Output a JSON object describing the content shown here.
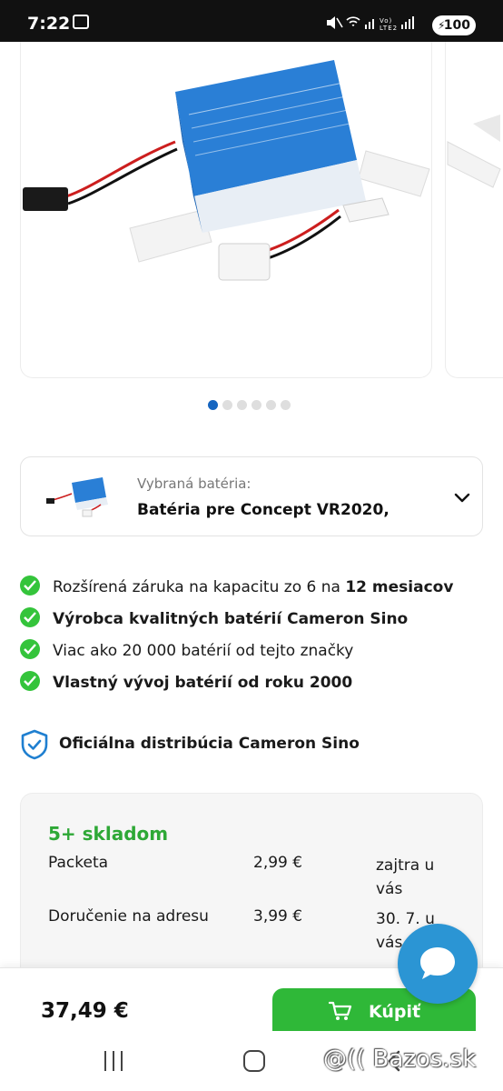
{
  "status_bar": {
    "time": "7:22",
    "signal_text": "Vo) LTE2",
    "battery": "100"
  },
  "gallery": {
    "dots_count": 6,
    "active_dot": 0
  },
  "selector": {
    "label": "Vybraná batéria:",
    "value": "Batéria pre Concept VR2020,"
  },
  "features": [
    {
      "pre": "Rozšírená záruka na kapacitu zo 6 na ",
      "bold": "12 mesiacov"
    },
    {
      "pre": "",
      "bold": "Výrobca kvalitných batérií Cameron Sino"
    },
    {
      "pre": "Viac ako 20 000 batérií od tejto značky",
      "bold": ""
    },
    {
      "pre": "",
      "bold": "Vlastný vývoj batérií od roku 2000"
    }
  ],
  "official": {
    "label": "Oficiálna distribúcia Cameron Sino"
  },
  "stock": {
    "title": "5+ skladom",
    "rows": [
      {
        "name": "Packeta",
        "price": "2,99 €",
        "when": "zajtra u vás"
      },
      {
        "name": "Doručenie na adresu",
        "price": "3,99 €",
        "when": "30. 7. u vás"
      }
    ]
  },
  "purchase": {
    "price": "37,49 €",
    "buy_label": "Kúpiť"
  },
  "watermark": "@(( Bazos.sk",
  "colors": {
    "accent_green": "#2fb838",
    "stock_green": "#2ea836",
    "check_green": "#34c43b",
    "brand_blue": "#1565c0",
    "chat_blue": "#2b95d4"
  }
}
